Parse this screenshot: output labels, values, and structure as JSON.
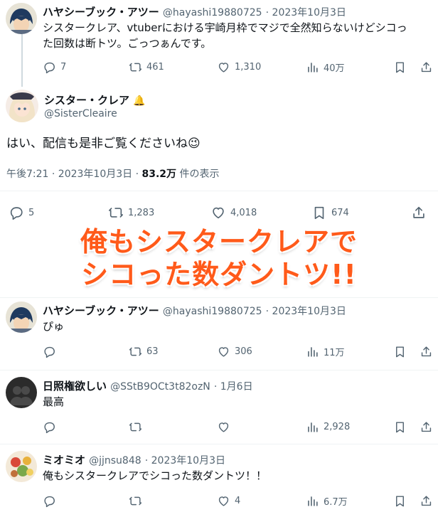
{
  "tweet1": {
    "name": "ハヤシーブック・アツー",
    "handle": "@hayashi19880725",
    "date": "· 2023年10月3日",
    "line1": "シスタークレア、vtuberにおける宇崎月枠でマジで全然知らないけどシコっ",
    "line2": "た回数は断トツ。ごっつぁんです。",
    "replies": "7",
    "retweets": "461",
    "likes": "1,310",
    "views": "40万"
  },
  "main": {
    "name": "シスター・クレア",
    "badge": "🔔",
    "handle": "@SisterCleaire",
    "text": "はい、配信も是非ご覧くださいね",
    "emoji": "😉",
    "time": "午後7:21 · 2023年10月3日 · ",
    "views_count": "83.2万",
    "views_label": " 件の表示",
    "replies": "5",
    "retweets": "1,283",
    "likes": "4,018",
    "bookmarks": "674"
  },
  "overlay": {
    "line1": "俺もシスタークレアで",
    "line2": "シコった数ダントツ!!"
  },
  "replies": [
    {
      "name": "ハヤシーブック・アツー",
      "handle": "@hayashi19880725",
      "date": "· 2023年10月3日",
      "text": "ぴゅ",
      "replies": "",
      "retweets": "63",
      "likes": "306",
      "views": "11万"
    },
    {
      "name": "日照権欲しい",
      "handle": "@SStB9OCt3t82ozN",
      "date": "· 1月6日",
      "text": "最高",
      "replies": "",
      "retweets": "",
      "likes": "",
      "views": "2,928"
    },
    {
      "name": "ミオミオ",
      "handle": "@jjnsu848",
      "date": "· 2023年10月3日",
      "text": "俺もシスタークレアでシコった数ダントツ！！",
      "replies": "",
      "retweets": "",
      "likes": "4",
      "views": "6.7万"
    }
  ],
  "colors": {
    "accent": "#ff5a1a",
    "secondary_text": "#536471",
    "divider": "#eff3f4"
  }
}
